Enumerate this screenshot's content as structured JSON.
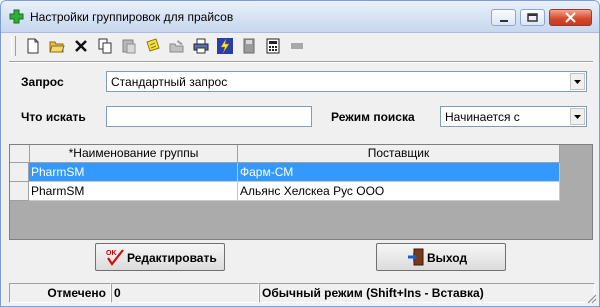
{
  "window": {
    "title": "Настройки группировок для прайсов",
    "icon": "green-cross-icon",
    "controls": [
      "minimize-icon",
      "maximize-icon",
      "close-icon"
    ]
  },
  "toolbar": {
    "buttons": [
      "new-file-icon",
      "open-folder-icon",
      "delete-x-icon",
      "copy-icon",
      "paste-icon",
      "note-icon",
      "folder-edit-icon",
      "print-icon",
      "lightning-icon",
      "save-disk-icon",
      "calculator-icon",
      "blank-icon"
    ]
  },
  "form": {
    "query_label": "Запрос",
    "query_value": "Стандартный запрос",
    "search_label": "Что искать",
    "search_value": "",
    "mode_label": "Режим поиска",
    "mode_value": "Начинается с"
  },
  "grid": {
    "columns": [
      "*Наименование группы",
      "Поставщик"
    ],
    "rows": [
      {
        "group": "PharmSM",
        "supplier": "Фарм-СМ",
        "selected": true
      },
      {
        "group": "PharmSM",
        "supplier": "Альянс Хелскеа Рус ООО",
        "selected": false
      }
    ],
    "selection_color": "#3399ff"
  },
  "buttons": {
    "edit_label": "Редактировать",
    "exit_label": "Выход"
  },
  "status": {
    "marked_label": "Отмечено",
    "marked_count": "0",
    "mode_text": "Обычный режим (Shift+Ins - Вставка)"
  }
}
